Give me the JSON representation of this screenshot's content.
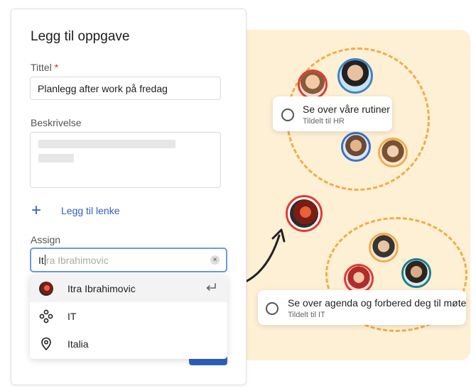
{
  "form": {
    "title": "Legg til oppgave",
    "title_label": "Tittel",
    "required_mark": "*",
    "title_value": "Planlegg after work på fredag",
    "description_label": "Beskrivelse",
    "add_link_label": "Legg til lenke",
    "assign_label": "Assign",
    "assign_typed_prefix": "It",
    "assign_suggestion": "ra Ibrahimovic",
    "clear_icon": "×",
    "dropdown": [
      {
        "label": "Itra Ibrahimovic",
        "icon": "avatar"
      },
      {
        "label": "IT",
        "icon": "group-icon"
      },
      {
        "label": "Italia",
        "icon": "location-pin-icon"
      }
    ]
  },
  "tasks": [
    {
      "title": "Se over våre rutiner",
      "subtitle": "Tildelt til HR"
    },
    {
      "title": "Se over agenda og forbered deg til møte",
      "subtitle": "Tildelt til IT"
    }
  ],
  "colors": {
    "accent": "#2f5fbf",
    "panel_bg": "#fdf0d5",
    "ring": "#f2ad45",
    "focus_border": "#6d99e3"
  }
}
